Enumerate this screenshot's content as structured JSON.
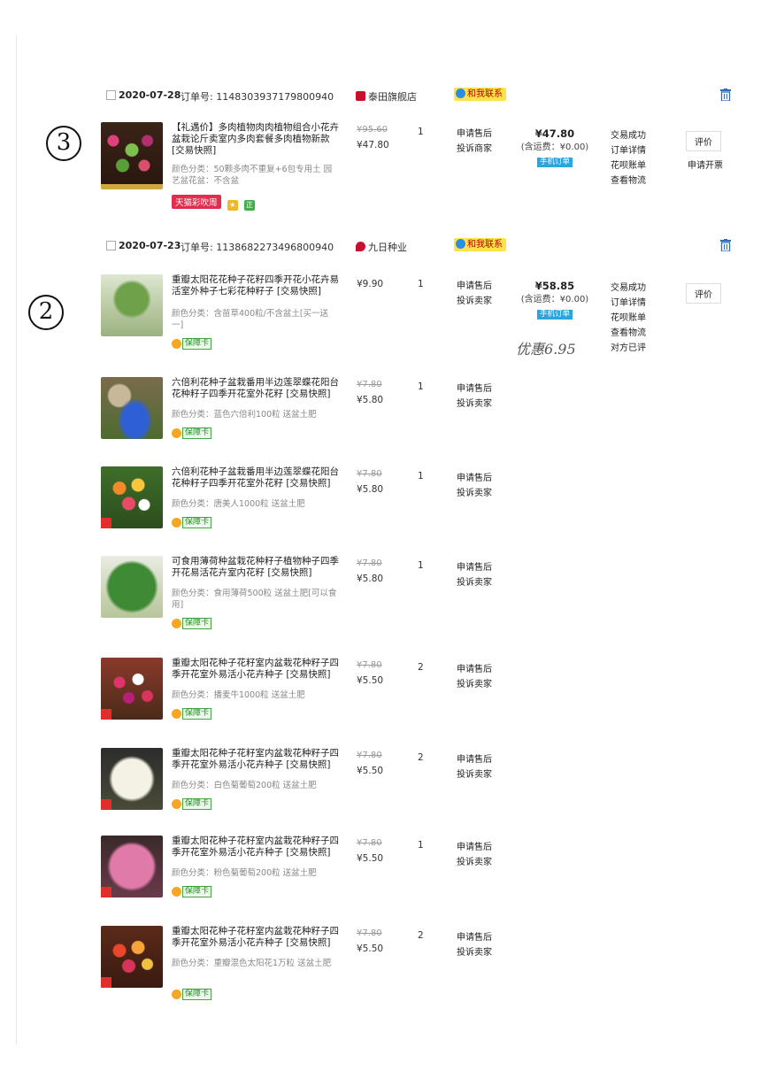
{
  "annotations": {
    "mark1": "3",
    "mark2": "2",
    "handwritten": "优惠6.95"
  },
  "orders": [
    {
      "date": "2020-07-28",
      "order_label": "订单号: 1148303937179800940",
      "shop": "泰田旗舰店",
      "contact": "和我联系",
      "total": "¥47.80",
      "shipping": "(含运费：¥0.00)",
      "mobile_tag": "手机订单",
      "status": [
        "交易成功",
        "订单详情",
        "花呗账单",
        "查看物流"
      ],
      "action_button": "评价",
      "action_text": "申请开票",
      "items": [
        {
          "title": "【礼遇价】多肉植物肉肉植物组合小花卉盆栽论斤卖室内多肉套餐多肉植物新款 [交易快照]",
          "spec": "颜色分类：50颗多肉不重复+6包专用土 园艺盆花盆：不含盆",
          "tag": "天猫彩吹周",
          "price_old": "¥95.60",
          "price_new": "¥47.80",
          "qty": "1",
          "service": [
            "申请售后",
            "投诉商家"
          ]
        }
      ]
    },
    {
      "date": "2020-07-23",
      "order_label": "订单号: 1138682273496800940",
      "shop": "九日种业",
      "contact": "和我联系",
      "total": "¥58.85",
      "shipping": "(含运费：¥0.00)",
      "mobile_tag": "手机订单",
      "status": [
        "交易成功",
        "订单详情",
        "花呗账单",
        "查看物流",
        "对方已评"
      ],
      "action_button": "评价",
      "badge": "保障卡",
      "items": [
        {
          "title": "重瓣太阳花花种子花籽四季开花小花卉易活室外种子七彩花种籽子 [交易快照]",
          "spec": "颜色分类：含苗草400粒/不含盆土[买一送一]",
          "price": "¥9.90",
          "qty": "1",
          "service": [
            "申请售后",
            "投诉卖家"
          ]
        },
        {
          "title": "六倍利花种子盆栽番用半边莲翠蝶花阳台花种籽子四季开花室外花籽 [交易快照]",
          "spec": "颜色分类：蓝色六倍利100粒 送盆土肥",
          "price_old": "¥7.80",
          "price_new": "¥5.80",
          "qty": "1",
          "service": [
            "申请售后",
            "投诉卖家"
          ]
        },
        {
          "title": "六倍利花种子盆栽番用半边莲翠蝶花阳台花种籽子四季开花室外花籽 [交易快照]",
          "spec": "颜色分类：唐美人1000粒 送盆土肥",
          "price_old": "¥7.80",
          "price_new": "¥5.80",
          "qty": "1",
          "service": [
            "申请售后",
            "投诉卖家"
          ]
        },
        {
          "title": "可食用薄荷种盆栽花种籽子植物种子四季开花易活花卉室内花籽 [交易快照]",
          "spec": "颜色分类：食用薄荷500粒 送盆土肥[可以食用]",
          "price_old": "¥7.80",
          "price_new": "¥5.80",
          "qty": "1",
          "service": [
            "申请售后",
            "投诉卖家"
          ]
        },
        {
          "title": "重瓣太阳花种子花籽室内盆栽花种籽子四季开花室外易活小花卉种子 [交易快照]",
          "spec": "颜色分类：播麦牛1000粒 送盆土肥",
          "price_old": "¥7.80",
          "price_new": "¥5.50",
          "qty": "2",
          "service": [
            "申请售后",
            "投诉卖家"
          ]
        },
        {
          "title": "重瓣太阳花种子花籽室内盆栽花种籽子四季开花室外易活小花卉种子 [交易快照]",
          "spec": "颜色分类：白色菊葡萄200粒 送盆土肥",
          "price_old": "¥7.80",
          "price_new": "¥5.50",
          "qty": "2",
          "service": [
            "申请售后",
            "投诉卖家"
          ]
        },
        {
          "title": "重瓣太阳花种子花籽室内盆栽花种籽子四季开花室外易活小花卉种子 [交易快照]",
          "spec": "颜色分类：粉色菊葡萄200粒 送盆土肥",
          "price_old": "¥7.80",
          "price_new": "¥5.50",
          "qty": "1",
          "service": [
            "申请售后",
            "投诉卖家"
          ]
        },
        {
          "title": "重瓣太阳花种子花籽室内盆栽花种籽子四季开花室外易活小花卉种子 [交易快照]",
          "spec": "颜色分类：重瓣混色太阳花1万粒 送盆土肥",
          "price_old": "¥7.80",
          "price_new": "¥5.50",
          "qty": "2",
          "service": [
            "申请售后",
            "投诉卖家"
          ]
        }
      ]
    }
  ]
}
